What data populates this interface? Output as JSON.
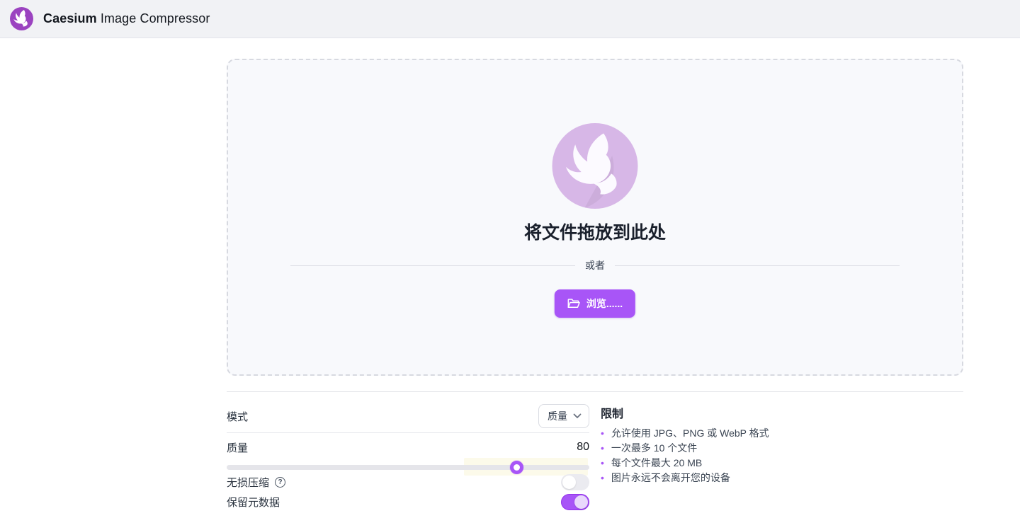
{
  "header": {
    "brand_bold": "Caesium",
    "brand_rest": " Image Compressor",
    "logo_icon": "caesium-bird-icon"
  },
  "dropzone": {
    "heading": "将文件拖放到此处",
    "or_label": "或者",
    "browse_button_label": "浏览......",
    "browse_icon": "folder-open-icon",
    "watermark_icon": "caesium-bird-icon"
  },
  "settings": {
    "mode": {
      "label": "模式",
      "selected_option": "质量",
      "chevron_icon": "chevron-down-icon"
    },
    "quality": {
      "label": "质量",
      "value": 80,
      "min": 0,
      "max": 100
    },
    "lossless": {
      "label": "无损压缩",
      "help_icon": "question-mark-icon",
      "help_glyph": "?",
      "enabled": false
    },
    "metadata": {
      "label": "保留元数据",
      "enabled": true
    }
  },
  "limits": {
    "heading": "限制",
    "bullet_glyph": "•",
    "items": [
      "允许使用 JPG、PNG 或 WebP 格式",
      "一次最多 10 个文件",
      "每个文件最大 20 MB",
      "图片永远不会离开您的设备"
    ]
  },
  "colors": {
    "accent": "#a855f7",
    "accent_dark": "#9333ea",
    "brand_purple": "#9b43c0",
    "lavender_watermark": "#d7b7e7",
    "toggle_off": "#ebebf0",
    "slider_track": "#e5e5ea",
    "header_bg": "#f1f2f5",
    "dropzone_bg": "#f8f9fc"
  }
}
